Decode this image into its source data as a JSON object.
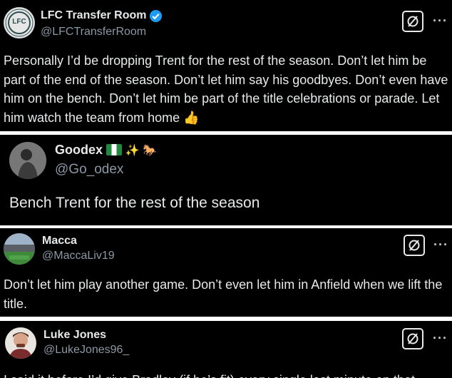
{
  "tweets": [
    {
      "name": "LFC Transfer Room",
      "handle": "@LFCTransferRoom",
      "verified": true,
      "avatar_text": "LFC",
      "text": "Personally I’d be dropping Trent for the rest of the season. Don’t let him be part of the end of the season. Don’t let him say his goodbyes. Don’t even have him on the bench. Don’t let him be part of the title celebrations or parade. Let him watch the team from home 👍",
      "more": "···"
    },
    {
      "name": "Goodex",
      "name_emojis": "✨ 🐎",
      "handle": "@Go_odex",
      "text": "Bench Trent for the rest of the season"
    },
    {
      "name": "Macca",
      "handle": "@MaccaLiv19",
      "text": "Don’t let him play another game. Don’t even let him in Anfield when we lift the title.",
      "more": "···"
    },
    {
      "name": "Luke Jones",
      "handle": "@LukeJones96_",
      "text": "I said it before I’d give Bradley (if he’s fit) every single last minute on that",
      "more": "···"
    }
  ],
  "colors": {
    "background": "#000000",
    "text": "#e7e9ea",
    "handle": "#8b98a5",
    "verified": "#1d9bf0",
    "divider": "#ffffff"
  }
}
